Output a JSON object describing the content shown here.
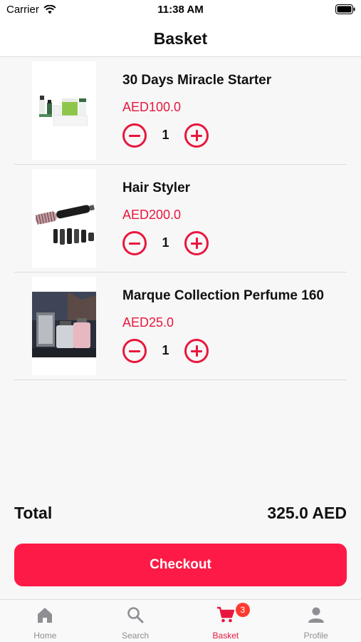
{
  "status_bar": {
    "carrier": "Carrier",
    "time": "11:38 AM"
  },
  "nav": {
    "title": "Basket"
  },
  "items": [
    {
      "name": "30 Days Miracle Starter",
      "price": "AED100.0",
      "qty": "1"
    },
    {
      "name": "Hair Styler",
      "price": "AED200.0",
      "qty": "1"
    },
    {
      "name": "Marque Collection Perfume 160",
      "price": "AED25.0",
      "qty": "1"
    }
  ],
  "summary": {
    "total_label": "Total",
    "total_value": "325.0 AED"
  },
  "checkout_label": "Checkout",
  "tabs": [
    {
      "label": "Home",
      "icon": "home-icon"
    },
    {
      "label": "Search",
      "icon": "search-icon"
    },
    {
      "label": "Basket",
      "icon": "cart-icon",
      "badge": "3",
      "active": true
    },
    {
      "label": "Profile",
      "icon": "profile-icon"
    }
  ],
  "colors": {
    "accent": "#e8173d",
    "checkout": "#fe1a46",
    "badge": "#ff3b30",
    "inactive": "#8e8e93"
  }
}
